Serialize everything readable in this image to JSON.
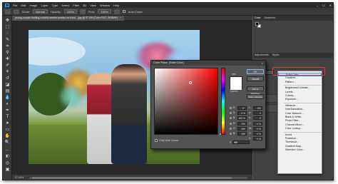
{
  "app": {
    "logo": "Ps",
    "menu": [
      "File",
      "Edit",
      "Image",
      "Layer",
      "Type",
      "Select",
      "Filter",
      "3D",
      "View",
      "Window",
      "Help"
    ],
    "window_controls": [
      "–",
      "☐",
      "✕"
    ]
  },
  "options": {
    "mode_label": "Mode:",
    "mode_value": "Normal",
    "opacity_label": "Opacity:",
    "opacity_value": "100%",
    "flow_label": "Flow:",
    "flow_value": "100%",
    "autoerase_label": "Auto-Erase"
  },
  "document": {
    "tab_title": "young-couple-holding-colorful-smoke-bombs-on-rural-...jpg @ 57.4% (Color Fill 1, RGB/8*)",
    "tab_close": "×",
    "zoom_status": "57.44%"
  },
  "panels": {
    "color_tabs": [
      "Color",
      "Swatches"
    ],
    "adjust_tabs": [
      "Adjustments",
      "Styles"
    ]
  },
  "dialog": {
    "title": "Color Picker (Solid Color)",
    "close": "×",
    "new_label": "new",
    "current_label": "current",
    "buttons": [
      "OK",
      "Cancel",
      "Add to Swatches",
      "Color Libraries"
    ],
    "only_web_colors": "Only Web Colors",
    "fields_left": [
      {
        "k": "H:",
        "v": "0 °"
      },
      {
        "k": "S:",
        "v": "0 %"
      },
      {
        "k": "B:",
        "v": "100 %"
      },
      {
        "k": "R:",
        "v": "255"
      },
      {
        "k": "G:",
        "v": "255"
      },
      {
        "k": "B:",
        "v": "255"
      }
    ],
    "fields_right": [
      {
        "k": "L:",
        "v": "100"
      },
      {
        "k": "a:",
        "v": "0"
      },
      {
        "k": "b:",
        "v": "0"
      },
      {
        "k": "C:",
        "v": "0 %"
      },
      {
        "k": "M:",
        "v": "0 %"
      },
      {
        "k": "Y:",
        "v": "0 %"
      },
      {
        "k": "K:",
        "v": "0 %"
      }
    ],
    "hex_label": "#",
    "hex_value": "ffffff"
  },
  "adjustment_menu": {
    "groups": [
      [
        "Solid Color...",
        "Gradient...",
        "Pattern..."
      ],
      [
        "Brightness/Contrast...",
        "Levels...",
        "Curves...",
        "Exposure..."
      ],
      [
        "Vibrance...",
        "Hue/Saturation...",
        "Color Balance...",
        "Black & White...",
        "Photo Filter...",
        "Channel Mixer...",
        "Color Lookup..."
      ],
      [
        "Invert",
        "Posterize...",
        "Threshold...",
        "Gradient Map...",
        "Selective Color..."
      ]
    ],
    "selected": "Solid Color..."
  },
  "colors": {
    "accent": "#31a8ff",
    "highlight": "#cce4f7",
    "callout": "#e53535",
    "picked": "#ffffff"
  }
}
